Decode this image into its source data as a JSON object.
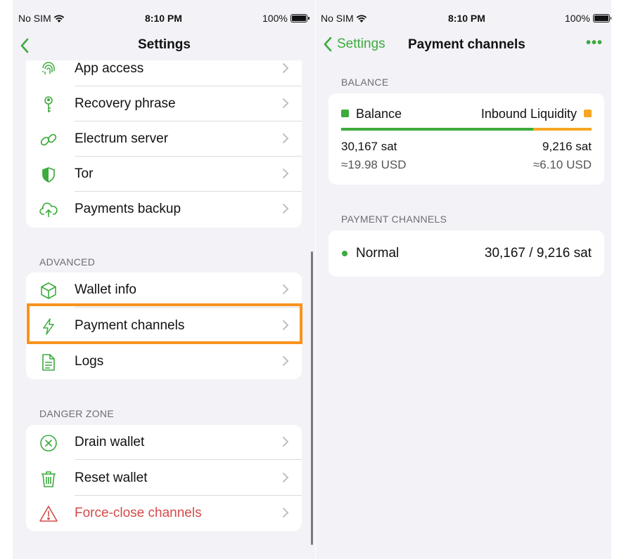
{
  "status": {
    "carrier": "No SIM",
    "time": "8:10 PM",
    "battery": "100%"
  },
  "left": {
    "nav_title": "Settings",
    "top_items": [
      {
        "label": "App access",
        "icon": "fingerprint-icon"
      },
      {
        "label": "Recovery phrase",
        "icon": "key-icon"
      },
      {
        "label": "Electrum server",
        "icon": "link-icon"
      },
      {
        "label": "Tor",
        "icon": "shield-icon"
      },
      {
        "label": "Payments backup",
        "icon": "cloud-upload-icon"
      }
    ],
    "advanced_header": "ADVANCED",
    "advanced_items": [
      {
        "label": "Wallet info",
        "icon": "cube-icon"
      },
      {
        "label": "Payment channels",
        "icon": "lightning-icon"
      },
      {
        "label": "Logs",
        "icon": "document-icon"
      }
    ],
    "danger_header": "DANGER ZONE",
    "danger_items": [
      {
        "label": "Drain wallet",
        "icon": "x-circle-icon"
      },
      {
        "label": "Reset wallet",
        "icon": "trash-icon"
      },
      {
        "label": "Force-close channels",
        "icon": "warning-icon"
      }
    ]
  },
  "right": {
    "back_label": "Settings",
    "nav_title": "Payment channels",
    "more_label": "•••",
    "balance_header": "BALANCE",
    "balance_label": "Balance",
    "inbound_label": "Inbound Liquidity",
    "balance_sat": "30,167 sat",
    "balance_usd": "≈19.98 USD",
    "inbound_sat": "9,216 sat",
    "inbound_usd": "≈6.10 USD",
    "balance_fraction": 0.766,
    "channels_header": "PAYMENT CHANNELS",
    "channel_state": "Normal",
    "channel_amount": "30,167 / 9,216 sat"
  },
  "colors": {
    "accent": "#3daa3d",
    "inbound": "#f5a623",
    "danger": "#d64a4a",
    "highlight": "#f7931e"
  }
}
